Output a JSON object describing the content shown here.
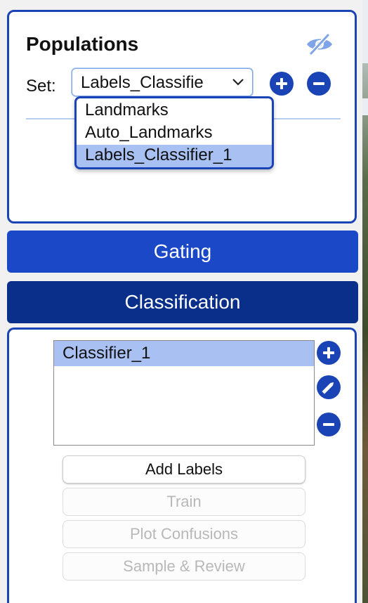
{
  "populations": {
    "title": "Populations",
    "visibility_icon": "eye-slash-icon",
    "set_label": "Set:",
    "set_selected": "Labels_Classifie",
    "add_icon": "plus-circle-icon",
    "remove_icon": "minus-circle-icon",
    "dropdown_options": [
      "Landmarks",
      "Auto_Landmarks",
      "Labels_Classifier_1"
    ],
    "dropdown_highlighted": "Labels_Classifier_1"
  },
  "sections": {
    "gating": "Gating",
    "classification": "Classification"
  },
  "classification": {
    "classifiers": [
      "Classifier_1"
    ],
    "selected_classifier": "Classifier_1",
    "side_icons": [
      "plus-circle-icon",
      "pencil-circle-icon",
      "minus-circle-icon"
    ],
    "buttons": {
      "add_labels": "Add Labels",
      "train": "Train",
      "plot_confusions": "Plot Confusions",
      "sample_review": "Sample & Review"
    },
    "enabled_buttons": [
      "Add Labels"
    ],
    "disabled_buttons": [
      "Train",
      "Plot Confusions",
      "Sample & Review"
    ]
  },
  "colors": {
    "accent": "#1a44b6",
    "gating_bar": "#1a48c6",
    "classification_bar": "#0a2f8a",
    "selection": "#a8c0f2",
    "visibility_icon": "#7fa5e8"
  }
}
